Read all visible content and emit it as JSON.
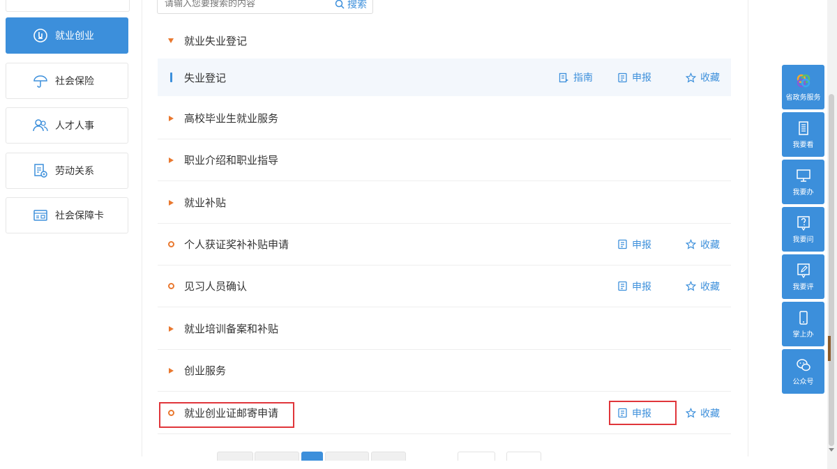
{
  "search": {
    "placeholder": "请输入您要搜索的内容",
    "button_label": "搜索"
  },
  "sidebar": {
    "items": [
      {
        "label": "就业创业",
        "icon": "employment-icon",
        "active": true
      },
      {
        "label": "社会保险",
        "icon": "umbrella-icon",
        "active": false
      },
      {
        "label": "人才人事",
        "icon": "people-icon",
        "active": false
      },
      {
        "label": "劳动关系",
        "icon": "document-icon",
        "active": false
      },
      {
        "label": "社会保障卡",
        "icon": "card-icon",
        "active": false
      }
    ]
  },
  "list": {
    "rows": [
      {
        "label": "就业失业登记",
        "type": "category-expanded"
      },
      {
        "label": "失业登记",
        "type": "subitem",
        "actions": [
          "指南",
          "申报",
          "收藏"
        ]
      },
      {
        "label": "高校毕业生就业服务",
        "type": "category"
      },
      {
        "label": "职业介绍和职业指导",
        "type": "category"
      },
      {
        "label": "就业补贴",
        "type": "category"
      },
      {
        "label": "个人获证奖补补贴申请",
        "type": "item",
        "actions": [
          "申报",
          "收藏"
        ]
      },
      {
        "label": "见习人员确认",
        "type": "item",
        "actions": [
          "申报",
          "收藏"
        ]
      },
      {
        "label": "就业培训备案和补贴",
        "type": "category"
      },
      {
        "label": "创业服务",
        "type": "category"
      },
      {
        "label": "就业创业证邮寄申请",
        "type": "item",
        "actions": [
          "申报",
          "收藏"
        ]
      }
    ]
  },
  "floatbar": {
    "items": [
      {
        "label": "省政务服务",
        "icon": "gov-service-logo-icon"
      },
      {
        "label": "我要看",
        "icon": "notebook-icon"
      },
      {
        "label": "我要办",
        "icon": "monitor-icon"
      },
      {
        "label": "我要问",
        "icon": "question-icon"
      },
      {
        "label": "我要评",
        "icon": "edit-icon"
      },
      {
        "label": "掌上办",
        "icon": "phone-icon"
      },
      {
        "label": "公众号",
        "icon": "wechat-icon"
      }
    ]
  },
  "colors": {
    "accent": "#3c8fdb",
    "marker": "#e9782f",
    "highlight": "#e0353a"
  }
}
